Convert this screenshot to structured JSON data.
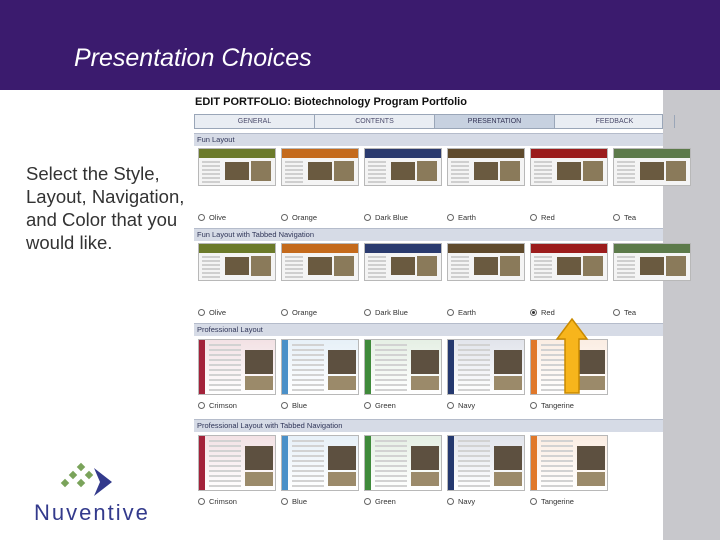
{
  "slide": {
    "title": "Presentation Choices",
    "instructions": "Select the Style, Layout, Navigation, and Color that you would like.",
    "logo_text": "Nuventive"
  },
  "portfolio": {
    "title": "EDIT PORTFOLIO: Biotechnology Program Portfolio",
    "tabs": [
      {
        "label": "GENERAL",
        "active": false
      },
      {
        "label": "CONTENTS",
        "active": false
      },
      {
        "label": "PRESENTATION",
        "active": true
      },
      {
        "label": "FEEDBACK",
        "active": false
      },
      {
        "label": "",
        "active": false
      }
    ],
    "sections": [
      {
        "header": "Fun Layout",
        "options": [
          {
            "label": "Olive",
            "color": "#6b7a2a",
            "selected": false
          },
          {
            "label": "Orange",
            "color": "#c46a1c",
            "selected": false
          },
          {
            "label": "Dark Blue",
            "color": "#2a3a6e",
            "selected": false
          },
          {
            "label": "Earth",
            "color": "#5f4a2c",
            "selected": false
          },
          {
            "label": "Red",
            "color": "#9b1c1c",
            "selected": false
          },
          {
            "label": "Tea",
            "color": "#5c7a4a",
            "selected": false
          }
        ]
      },
      {
        "header": "Fun Layout with Tabbed Navigation",
        "options": [
          {
            "label": "Olive",
            "color": "#6b7a2a",
            "selected": false
          },
          {
            "label": "Orange",
            "color": "#c46a1c",
            "selected": false
          },
          {
            "label": "Dark Blue",
            "color": "#2a3a6e",
            "selected": false
          },
          {
            "label": "Earth",
            "color": "#5f4a2c",
            "selected": false
          },
          {
            "label": "Red",
            "color": "#9b1c1c",
            "selected": true
          },
          {
            "label": "Tea",
            "color": "#5c7a4a",
            "selected": false
          }
        ]
      },
      {
        "header": "Professional Layout",
        "options": [
          {
            "label": "Crimson",
            "color": "#a3223a",
            "selected": false
          },
          {
            "label": "Blue",
            "color": "#4a90c8",
            "selected": false
          },
          {
            "label": "Green",
            "color": "#3f8a3a",
            "selected": false
          },
          {
            "label": "Navy",
            "color": "#24386e",
            "selected": false
          },
          {
            "label": "Tangerine",
            "color": "#e0782a",
            "selected": false
          }
        ]
      },
      {
        "header": "Professional Layout with Tabbed Navigation",
        "options": [
          {
            "label": "Crimson",
            "color": "#a3223a",
            "selected": false
          },
          {
            "label": "Blue",
            "color": "#4a90c8",
            "selected": false
          },
          {
            "label": "Green",
            "color": "#3f8a3a",
            "selected": false
          },
          {
            "label": "Navy",
            "color": "#24386e",
            "selected": false
          },
          {
            "label": "Tangerine",
            "color": "#e0782a",
            "selected": false
          }
        ]
      }
    ]
  },
  "colors": {
    "header_bar": "#3b1b6e",
    "arrow_fill": "#f7b51c",
    "arrow_outline": "#c98a00"
  },
  "icons": {
    "arrow": "up-arrow-icon",
    "logo": "nuventive-logo-icon"
  }
}
